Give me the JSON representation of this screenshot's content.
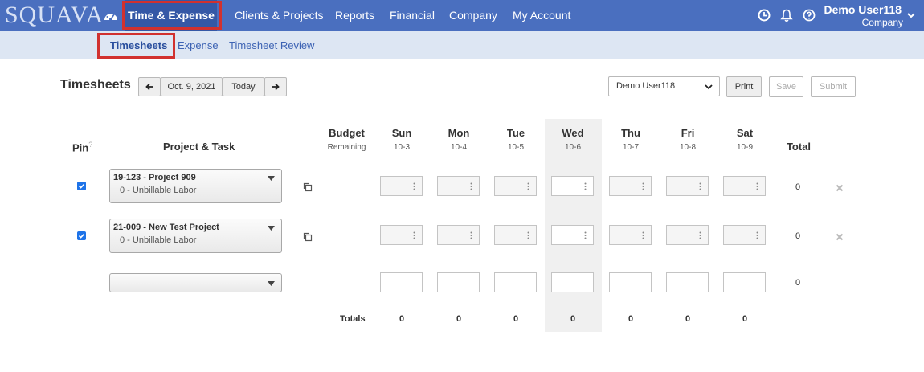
{
  "app": {
    "logo": "SQUAVA",
    "nav": [
      "Time & Expense",
      "Clients & Projects",
      "Reports",
      "Financial",
      "Company",
      "My Account"
    ],
    "user": {
      "name": "Demo User118",
      "company": "Company"
    }
  },
  "subnav": [
    "Timesheets",
    "Expense",
    "Timesheet Review"
  ],
  "toolbar": {
    "title": "Timesheets",
    "prev_label": "←",
    "date": "Oct. 9, 2021",
    "today": "Today",
    "next_label": "→",
    "user_select": "Demo User118",
    "print": "Print",
    "save": "Save",
    "submit": "Submit"
  },
  "grid": {
    "headers": {
      "pin": "Pin",
      "pin_help": "?",
      "project_task": "Project & Task",
      "budget": "Budget",
      "budget_sub": "Remaining",
      "total": "Total"
    },
    "days": [
      {
        "name": "Sun",
        "date": "10-3"
      },
      {
        "name": "Mon",
        "date": "10-4"
      },
      {
        "name": "Tue",
        "date": "10-5"
      },
      {
        "name": "Wed",
        "date": "10-6"
      },
      {
        "name": "Thu",
        "date": "10-7"
      },
      {
        "name": "Fri",
        "date": "10-8"
      },
      {
        "name": "Sat",
        "date": "10-9"
      }
    ],
    "rows": [
      {
        "project": "19-123 - Project 909",
        "task": "0 - Unbillable Labor",
        "pinned": true,
        "total": "0"
      },
      {
        "project": "21-009 - New Test Project",
        "task": "0 - Unbillable Labor",
        "pinned": true,
        "total": "0"
      },
      {
        "project": "",
        "task": "",
        "pinned": false,
        "total": "0"
      }
    ],
    "totals_label": "Totals",
    "totals": [
      "0",
      "0",
      "0",
      "0",
      "0",
      "0",
      "0"
    ]
  },
  "colors": {
    "nav_bg": "#4a6fbf",
    "nav_active": "#3558a6",
    "subnav_bg": "#dde6f3",
    "highlight": "#d1312f",
    "checkbox": "#1e73e8"
  },
  "icons": [
    "dashboard-icon",
    "clock-icon",
    "bell-icon",
    "help-icon",
    "chevron-down-icon",
    "copy-icon",
    "close-icon"
  ]
}
